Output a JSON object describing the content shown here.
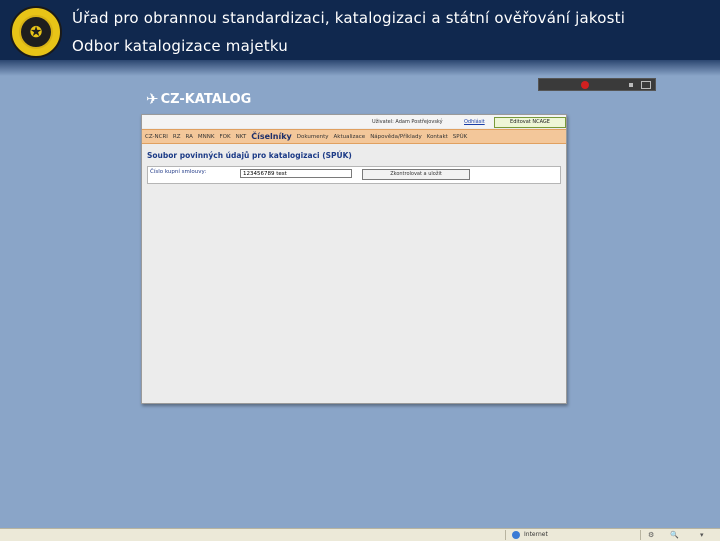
{
  "header": {
    "title": "Úřad pro obrannou standardizaci, katalogizaci a státní ověřování jakosti",
    "subtitle": "Odbor katalogizace majetku"
  },
  "app": {
    "logo_text": "CZ-KATALOG"
  },
  "userbar": {
    "user_label": "Uživatel: Adam Postřejovský",
    "logout_label": "Odhlásit",
    "edit_button": "Editovat NCAGE"
  },
  "menu": {
    "items": [
      "CZ-NCRI",
      "RZ",
      "RA",
      "MNNK",
      "FOK",
      "NKT",
      "Číselníky",
      "Dokumenty",
      "Aktualizace",
      "Nápověda/Příklady",
      "Kontakt",
      "SPÚK"
    ],
    "active": "Číselníky"
  },
  "main": {
    "section_title": "Soubor povinných údajů pro katalogizaci (SPÚK)",
    "form": {
      "label": "Číslo kupní smlouvy:",
      "value": "123456789 test",
      "button": "Zkontrolovat a uložit"
    }
  },
  "statusbar": {
    "zone": "Internet"
  },
  "colors": {
    "banner": "#10284e",
    "background": "#8aa5c8",
    "menu": "#f3c79a",
    "accent": "#1b3a86"
  }
}
